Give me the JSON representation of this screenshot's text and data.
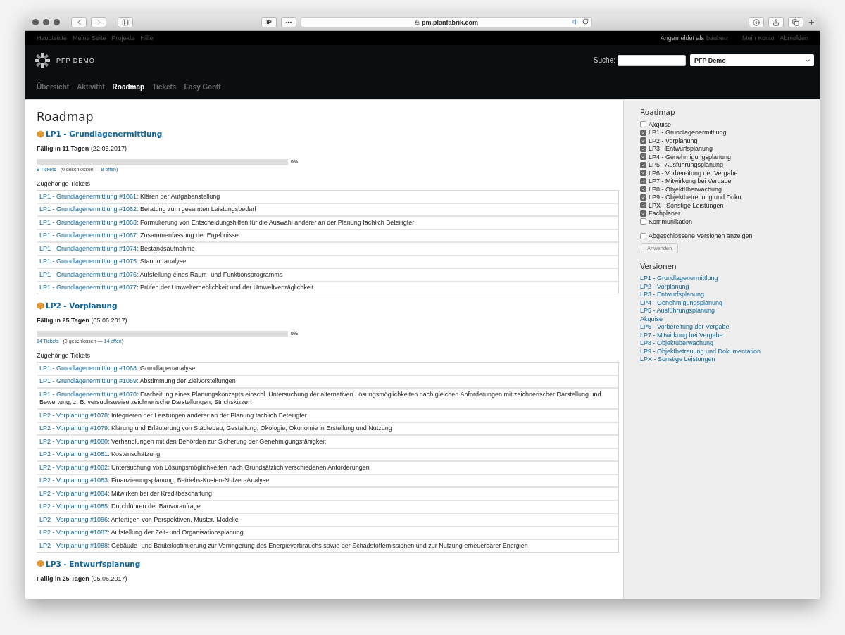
{
  "browser": {
    "buttons": [
      "IP",
      "•••"
    ],
    "url": "pm.planfabrik.com"
  },
  "top_menu": {
    "items": [
      "Hauptseite",
      "Meine Seite",
      "Projekte",
      "Hilfe"
    ],
    "logged_in_label": "Angemeldet als",
    "user": "bauherr",
    "right_items": [
      "Mein Konto",
      "Abmelden"
    ]
  },
  "header": {
    "project_name": "PFP DEMO",
    "search_label": "Suche:",
    "project_select": "PFP Demo"
  },
  "tabs": [
    {
      "label": "Übersicht",
      "selected": false
    },
    {
      "label": "Aktivität",
      "selected": false
    },
    {
      "label": "Roadmap",
      "selected": true
    },
    {
      "label": "Tickets",
      "selected": false
    },
    {
      "label": "Easy Gantt",
      "selected": false
    }
  ],
  "main": {
    "title": "Roadmap",
    "versions": [
      {
        "name": "LP1 - Grundlagenermittlung",
        "due_label": "Fällig in 11 Tagen",
        "due_date": "(22.05.2017)",
        "level": 0,
        "percent": "0%",
        "tickets_link": "8 Tickets",
        "stats_before": "(0 geschlossen —",
        "open_link": "8 offen",
        "stats_after": ")",
        "related_label": "Zugehörige Tickets",
        "tickets": [
          {
            "ref": "LP1 - Grundlagenermittlung #1061",
            "subject": ": Klären der Aufgabenstellung"
          },
          {
            "ref": "LP1 - Grundlagenermittlung #1062",
            "subject": ": Beratung zum gesamten Leistungsbedarf"
          },
          {
            "ref": "LP1 - Grundlagenermittlung #1063",
            "subject": ": Formulierung von Entscheidungshilfen für die Auswahl anderer an der Planung fachlich Beteiligter"
          },
          {
            "ref": "LP1 - Grundlagenermittlung #1067",
            "subject": ": Zusammenfassung der Ergebnisse"
          },
          {
            "ref": "LP1 - Grundlagenermittlung #1074",
            "subject": ": Bestandsaufnahme"
          },
          {
            "ref": "LP1 - Grundlagenermittlung #1075",
            "subject": ": Standortanalyse"
          },
          {
            "ref": "LP1 - Grundlagenermittlung #1076",
            "subject": ": Aufstellung eines Raum- und Funktionsprogramms"
          },
          {
            "ref": "LP1 - Grundlagenermittlung #1077",
            "subject": ": Prüfen der Umwelterheblichkeit und der Umweltverträglichkeit"
          }
        ]
      },
      {
        "name": "LP2 - Vorplanung",
        "due_label": "Fällig in 25 Tagen",
        "due_date": "(05.06.2017)",
        "level": 0,
        "percent": "0%",
        "tickets_link": "14 Tickets",
        "stats_before": "(0 geschlossen —",
        "open_link": "14 offen",
        "stats_after": ")",
        "related_label": "Zugehörige Tickets",
        "tickets": [
          {
            "ref": "LP1 - Grundlagenermittlung #1068",
            "subject": ": Grundlagenanalyse"
          },
          {
            "ref": "LP1 - Grundlagenermittlung #1069",
            "subject": ": Abstimmung der Zielvorstellungen"
          },
          {
            "ref": "LP1 - Grundlagenermittlung #1070",
            "subject": ": Erarbeitung eines Planungskonzepts einschl. Untersuchung der alternativen Lösungsmöglichkeiten nach gleichen Anforderungen mit zeichnerischer Darstellung und Bewertung, z. B. versuchsweise zeichnerische Darstellungen, Strichskizzen"
          },
          {
            "ref": "LP2 - Vorplanung #1078",
            "subject": ": Integrieren der Leistungen anderer an der Planung fachlich Beteiligter"
          },
          {
            "ref": "LP2 - Vorplanung #1079",
            "subject": ": Klärung und Erläuterung von Städtebau, Gestaltung, Ökologie, Ökonomie in Erstellung und Nutzung"
          },
          {
            "ref": "LP2 - Vorplanung #1080",
            "subject": ": Verhandlungen mit den Behörden zur Sicherung der Genehmigungsfähigkeit"
          },
          {
            "ref": "LP2 - Vorplanung #1081",
            "subject": ": Kostenschätzung"
          },
          {
            "ref": "LP2 - Vorplanung #1082",
            "subject": ": Untersuchung von Lösungsmöglichkeiten nach Grundsätzlich verschiedenen Anforderungen"
          },
          {
            "ref": "LP2 - Vorplanung #1083",
            "subject": ": Finanzierungsplanung, Betriebs-Kosten-Nutzen-Analyse"
          },
          {
            "ref": "LP2 - Vorplanung #1084",
            "subject": ": Mitwirken bei der Kreditbeschaffung"
          },
          {
            "ref": "LP2 - Vorplanung #1085",
            "subject": ": Durchführen der Bauvoranfrage"
          },
          {
            "ref": "LP2 - Vorplanung #1086",
            "subject": ": Anfertigen von Perspektiven, Muster, Modelle"
          },
          {
            "ref": "LP2 - Vorplanung #1087",
            "subject": ": Aufstellung der Zeit- und Organisationsplanung"
          },
          {
            "ref": "LP2 - Vorplanung #1088",
            "subject": ": Gebäude- und Bauteiloptimierung zur Verringerung des Energieverbrauchs sowie der Schadstoffemissionen und zur Nutzung erneuerbarer Energien"
          }
        ]
      },
      {
        "name": "LP3 - Entwurfsplanung",
        "due_label": "Fällig in 25 Tagen",
        "due_date": "(05.06.2017)"
      }
    ]
  },
  "sidebar": {
    "title": "Roadmap",
    "filters": [
      {
        "label": "Akquise",
        "checked": false
      },
      {
        "label": "LP1 - Grundlagenermittlung",
        "checked": true
      },
      {
        "label": "LP2 - Vorplanung",
        "checked": true
      },
      {
        "label": "LP3 - Entwurfsplanung",
        "checked": true
      },
      {
        "label": "LP4 - Genehmigungsplanung",
        "checked": true
      },
      {
        "label": "LP5 - Ausführungsplanung",
        "checked": true
      },
      {
        "label": "LP6 - Vorbereitung der Vergabe",
        "checked": true
      },
      {
        "label": "LP7 - Mitwirkung bei Vergabe",
        "checked": true
      },
      {
        "label": "LP8 - Objektüberwachung",
        "checked": true
      },
      {
        "label": "LP9 - Objektbetreuung und Doku",
        "checked": true
      },
      {
        "label": "LPX - Sonstige Leistungen",
        "checked": true
      },
      {
        "label": "Fachplaner",
        "checked": true
      },
      {
        "label": "Kommunikation",
        "checked": false
      }
    ],
    "completed": {
      "label": "Abgeschlossene Versionen anzeigen",
      "checked": false
    },
    "apply_button": "Anwenden",
    "versions_title": "Versionen",
    "version_links": [
      "LP1 - Grundlagenermittlung",
      "LP2 - Vorplanung",
      "LP3 - Entwurfsplanung",
      "LP4 - Genehmigungsplanung",
      "LP5 - Ausführungsplanung",
      "Akquise",
      "LP6 - Vorbereitung der Vergabe",
      "LP7 - Mitwirkung bei Vergabe",
      "LP8 - Objektüberwachung",
      "LP9 - Objektbetreuung und Dokumentation",
      "LPX - Sonstige Leistungen"
    ]
  }
}
